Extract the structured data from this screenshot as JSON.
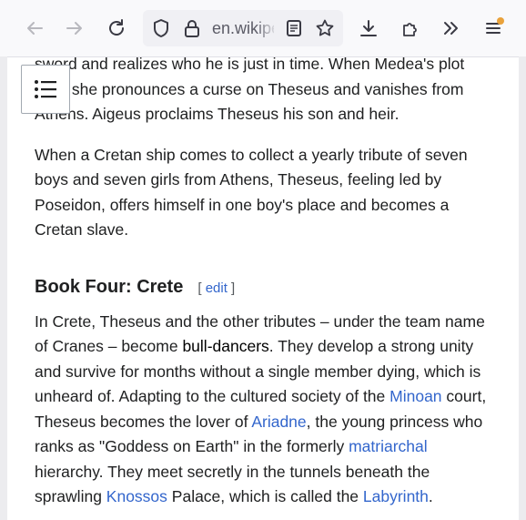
{
  "browser": {
    "url_text": "en.wikipe",
    "icons": [
      "back-arrow-icon",
      "forward-arrow-icon",
      "reload-icon",
      "shield-icon",
      "lock-icon",
      "reader-view-icon",
      "bookmark-star-icon",
      "download-icon",
      "extensions-icon",
      "overflow-chevrons-icon",
      "menu-icon"
    ],
    "accent_dot_color": "#e9a23b"
  },
  "toc": {
    "icon": "table-of-contents-icon"
  },
  "article": {
    "para1": {
      "line1": "sword and realizes who he is just in time. When Medea's plot",
      "line2": "fails, she pronounces a curse on Theseus and vanishes from",
      "line3": "Athens. Aigeus proclaims Theseus his son and heir."
    },
    "para2": "When a Cretan ship comes to collect a yearly tribute of seven boys and seven girls from Athens, Theseus, feeling led by Poseidon, offers himself in one boy's place and becomes a Cretan slave.",
    "section": {
      "title": "Book Four: Crete",
      "edit_open": "[ ",
      "edit_label": "edit",
      "edit_close": " ]"
    },
    "para3": {
      "t1": "In Crete, Theseus and the other tributes – under the team name of Cranes – become ",
      "link_bull": "bull-dancers",
      "t2": ". They develop a strong unity and survive for months without a single member dying, which is unheard of. Adapting to the cultured society of the ",
      "link_minoan": "Minoan",
      "t3": " court, Theseus becomes the lover of ",
      "link_ariadne": "Ariadne",
      "t4": ", the young princess who ranks as \"Goddess on Earth\" in the formerly ",
      "link_matriarchal": "matriarchal",
      "t5": " hierarchy. They meet secretly in the tunnels beneath the sprawling ",
      "link_knossos": "Knossos",
      "t6": " Palace, which is called the ",
      "link_labyrinth": "Labyrinth",
      "t7": "."
    }
  },
  "colors": {
    "link": "#3366cc",
    "text": "#202122"
  }
}
